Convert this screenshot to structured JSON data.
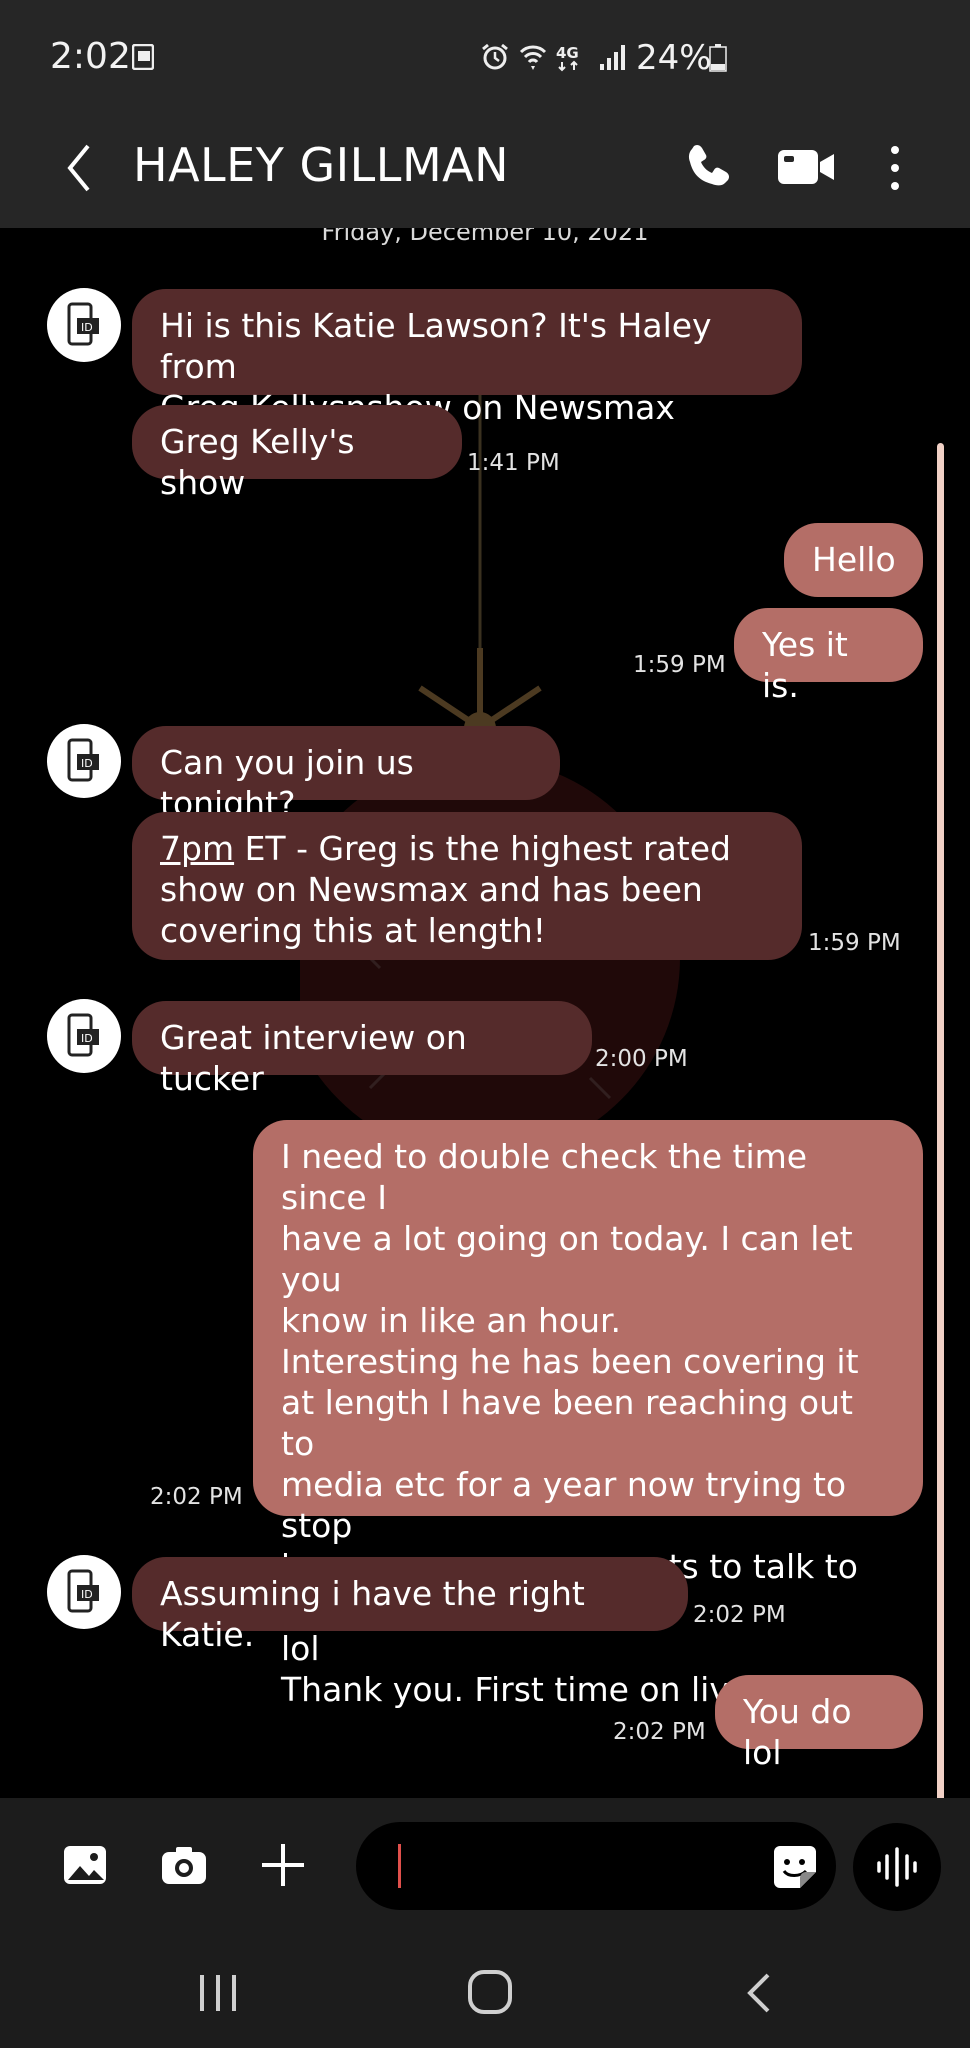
{
  "status_bar": {
    "time": "2:02",
    "battery": "24%",
    "network": "4G"
  },
  "header": {
    "contact_name": "HALEY GILLMAN"
  },
  "conversation": {
    "date": "Friday, December 10, 2021",
    "messages": [
      {
        "dir": "in",
        "text": "Hi is this Katie Lawson? It's Haley from\nGreg Kellysnshow on Newsmax",
        "time": ""
      },
      {
        "dir": "in",
        "text": "Greg Kelly's show",
        "time": "1:41 PM"
      },
      {
        "dir": "out",
        "text": "Hello",
        "time": ""
      },
      {
        "dir": "out",
        "text": "Yes it is.",
        "time": "1:59 PM"
      },
      {
        "dir": "in",
        "text": "Can you join us tonight?",
        "time": ""
      },
      {
        "dir": "in",
        "link": "7pm",
        "text": " ET - Greg is the highest rated\nshow on Newsmax and has been\ncovering this at length!",
        "time": "1:59 PM"
      },
      {
        "dir": "in",
        "text": "Great interview on tucker",
        "time": "2:00 PM"
      },
      {
        "dir": "out",
        "text": "I need to double check the time since I\nhave a lot going on today. I can let you\nknow in like an hour.\nInteresting he has been covering it\nat length I have been reaching out to\nmedia etc for a year now trying to stop\nher, now everyone wants to talk to me\nlol\nThank you. First time on live TV.",
        "time": "2:02 PM"
      },
      {
        "dir": "in",
        "text": "Assuming i have the right Katie.",
        "time": "2:02 PM"
      },
      {
        "dir": "out",
        "text": "You do lol",
        "time": "2:02 PM"
      }
    ]
  },
  "icons": {
    "back": "chevron-left-icon",
    "call": "phone-icon",
    "video": "video-call-icon",
    "more": "more-vertical-icon",
    "gallery": "image-icon",
    "camera": "camera-icon",
    "add": "plus-icon",
    "sticker": "sticker-icon",
    "voice": "voice-waveform-icon"
  },
  "colors": {
    "incoming_bubble": "#552b2b",
    "outgoing_bubble": "#b46e67",
    "bars": "#262626",
    "cursor": "#e0504c"
  }
}
